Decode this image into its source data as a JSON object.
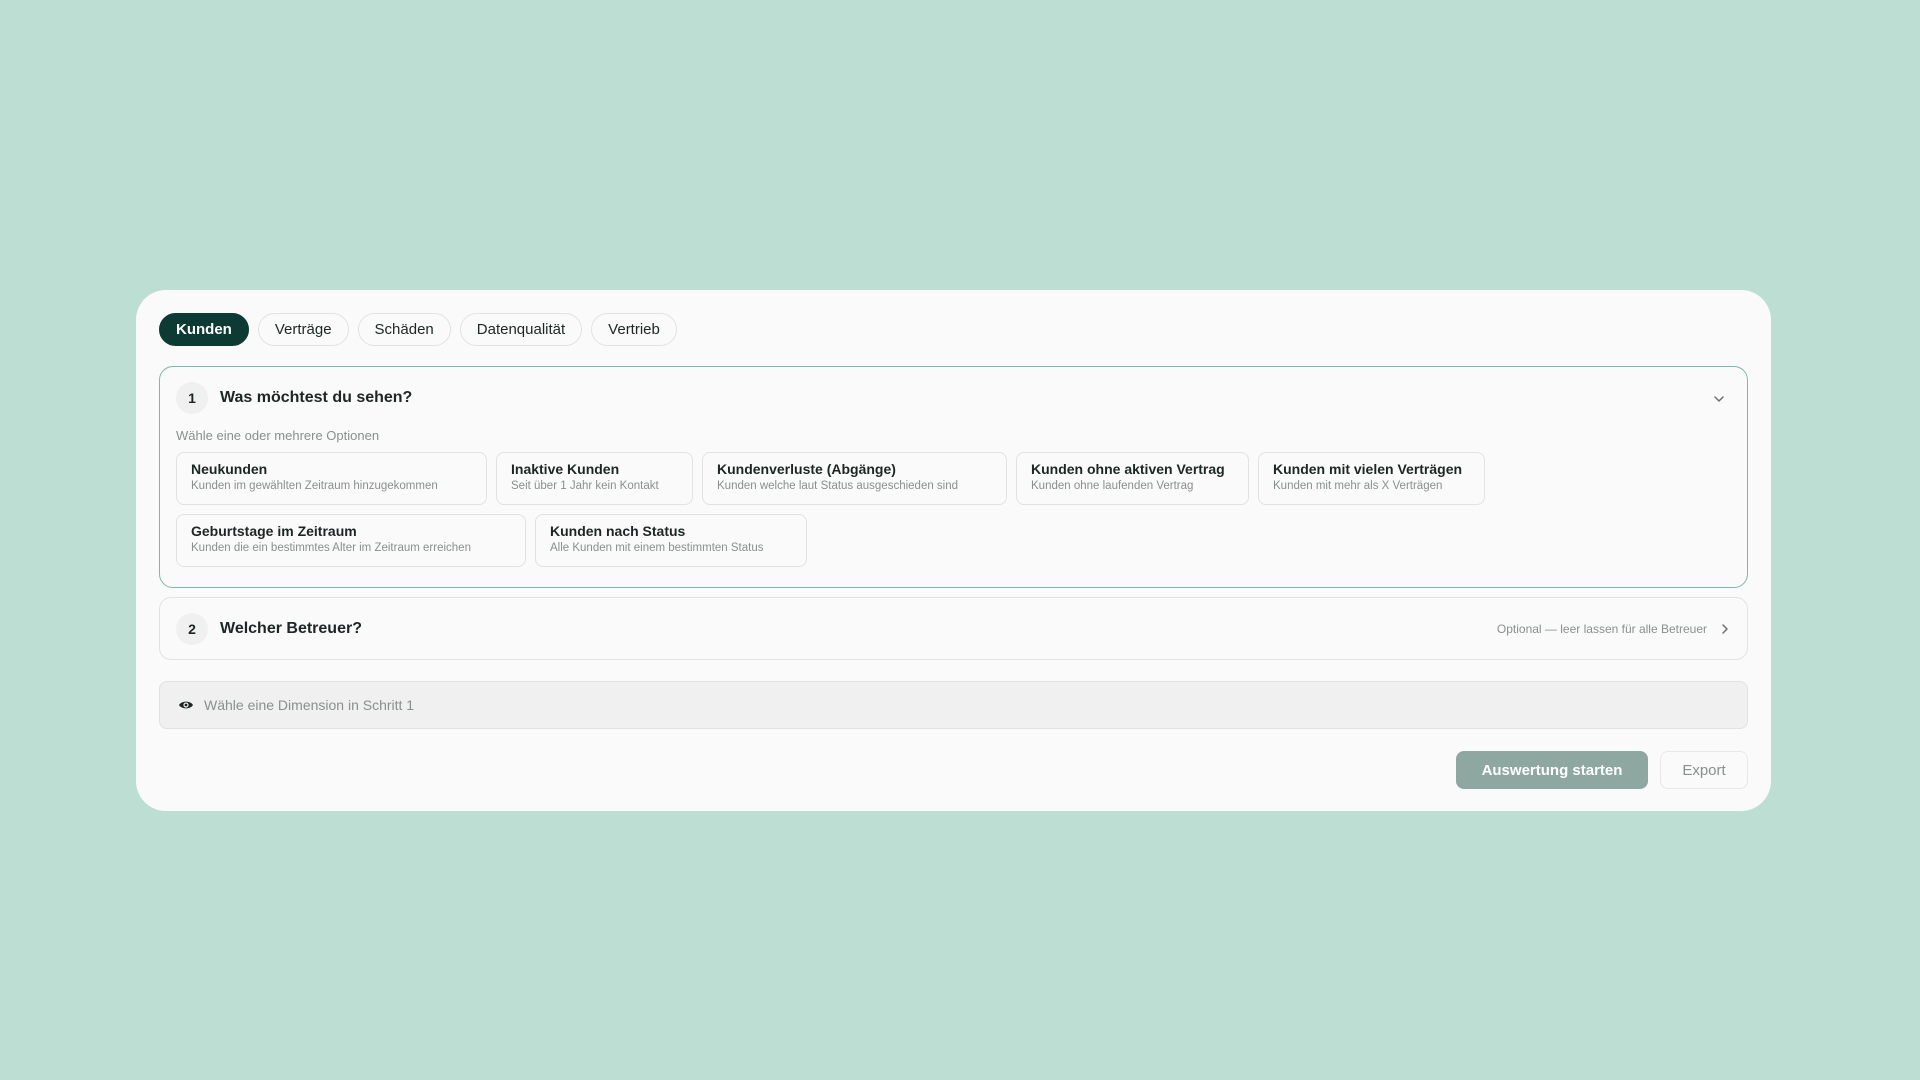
{
  "tabs": [
    {
      "label": "Kunden",
      "active": true
    },
    {
      "label": "Verträge",
      "active": false
    },
    {
      "label": "Schäden",
      "active": false
    },
    {
      "label": "Datenqualität",
      "active": false
    },
    {
      "label": "Vertrieb",
      "active": false
    }
  ],
  "step1": {
    "number": "1",
    "title": "Was möchtest du sehen?",
    "hint": "Wähle eine oder mehrere Optionen",
    "toggle_icon": "chevron-down-icon",
    "options": [
      {
        "title": "Neukunden",
        "subtitle": "Kunden im gewählten Zeitraum hinzugekommen"
      },
      {
        "title": "Inaktive Kunden",
        "subtitle": "Seit über 1 Jahr kein Kontakt"
      },
      {
        "title": "Kundenverluste (Abgänge)",
        "subtitle": "Kunden welche laut Status ausgeschieden sind"
      },
      {
        "title": "Kunden ohne aktiven Vertrag",
        "subtitle": "Kunden ohne laufenden Vertrag"
      },
      {
        "title": "Kunden mit vielen Verträgen",
        "subtitle": "Kunden mit mehr als X Verträgen"
      },
      {
        "title": "Geburtstage im Zeitraum",
        "subtitle": "Kunden die ein bestimmtes Alter im Zeitraum erreichen"
      },
      {
        "title": "Kunden nach Status",
        "subtitle": "Alle Kunden mit einem bestimmten Status"
      }
    ]
  },
  "step2": {
    "number": "2",
    "title": "Welcher Betreuer?",
    "optional_text": "Optional — leer lassen für alle Betreuer",
    "toggle_icon": "chevron-right-icon"
  },
  "preview": {
    "icon": "eye-icon",
    "text": "Wähle eine Dimension in Schritt 1"
  },
  "actions": {
    "start_label": "Auswertung starten",
    "export_label": "Export"
  },
  "colors": {
    "background": "#bcded3",
    "card": "#fafafa",
    "active_tab": "#0d3a33",
    "step_border_active": "#7cb8ac",
    "primary_button": "#8fa7a1",
    "muted_text": "#8a8f8d"
  }
}
